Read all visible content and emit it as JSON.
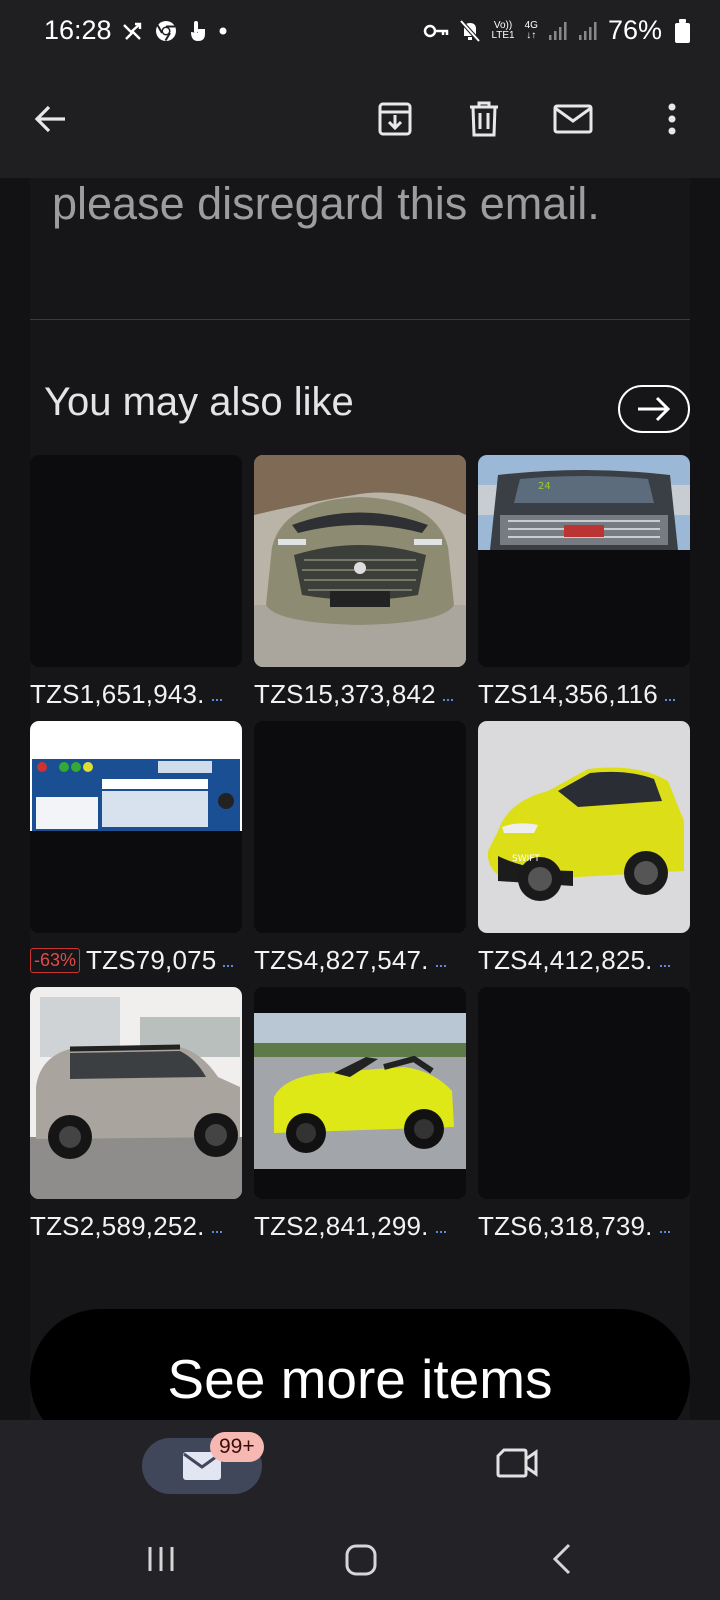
{
  "status_bar": {
    "time": "16:28",
    "left_icons": [
      "missed-call-icon",
      "chrome-icon",
      "touch-icon",
      "dot-icon"
    ],
    "vo_lte": "Vo))\nLTE1",
    "network": "4G",
    "battery": "76%"
  },
  "app_bar": {
    "actions": [
      "back-icon",
      "archive-icon",
      "delete-icon",
      "mark-unread-icon",
      "more-icon"
    ]
  },
  "email": {
    "disregard_text": "please disregard this email.",
    "section_title": "You may also like",
    "items": [
      {
        "price": "TZS1,651,943.",
        "discount": "",
        "image": "empty"
      },
      {
        "price": "TZS15,373,842",
        "discount": "",
        "image": "green-suv"
      },
      {
        "price": "TZS14,356,116",
        "discount": "",
        "image": "gmc-truck"
      },
      {
        "price": "TZS79,075",
        "discount": "-63%",
        "image": "lcd-tester"
      },
      {
        "price": "TZS4,827,547.",
        "discount": "",
        "image": "empty"
      },
      {
        "price": "TZS4,412,825.",
        "discount": "",
        "image": "yellow-swift"
      },
      {
        "price": "TZS2,589,252.",
        "discount": "",
        "image": "grey-mini"
      },
      {
        "price": "TZS2,841,299.",
        "discount": "",
        "image": "yellow-convertible"
      },
      {
        "price": "TZS6,318,739.",
        "discount": "",
        "image": "empty"
      }
    ],
    "see_more_label": "See more items"
  },
  "bottom_nav": {
    "mail_badge": "99+"
  },
  "colors": {
    "background": "#121214",
    "accent_pill": "#40475a",
    "badge": "#f7b8b1",
    "discount": "#e34a4a"
  }
}
